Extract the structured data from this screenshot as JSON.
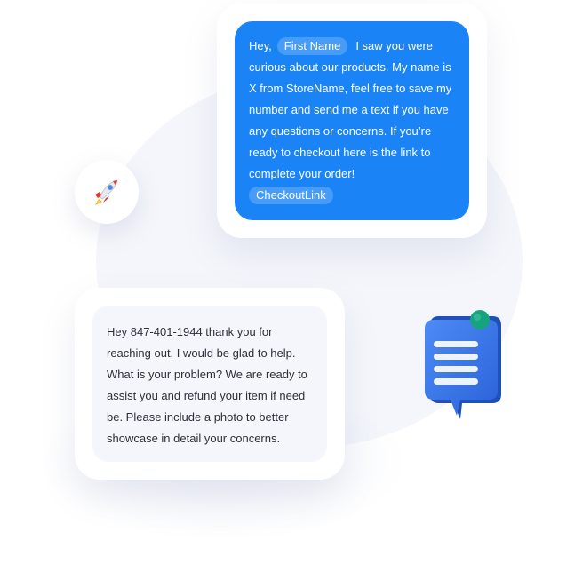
{
  "outgoing_message": {
    "greeting": "Hey,",
    "name_tag": "First Name",
    "lines": [
      "I saw you were",
      "curious about our products. My name is",
      "X from StoreName, feel free to save my",
      "number and send me a text if you have",
      "any questions or concerns. If you’re",
      "ready to checkout here is the link to",
      "complete your order!"
    ],
    "link_tag": "CheckoutLink"
  },
  "incoming_message": {
    "lines": [
      "Hey 847-401-1944 thank you for",
      "reaching out. I would be glad to help.",
      "What is your problem? We are ready to",
      "assist you and refund your item if need",
      "be. Please include a photo to better",
      "showcase in detail your concerns."
    ]
  },
  "icons": {
    "rocket": "rocket-icon",
    "chat": "chat-bubble-icon"
  },
  "colors": {
    "outgoing_bubble": "#1a84f7",
    "incoming_bubble": "#f4f6fb",
    "chat_icon_blue": "#2f6fe6",
    "notification_dot": "#17a37f"
  }
}
